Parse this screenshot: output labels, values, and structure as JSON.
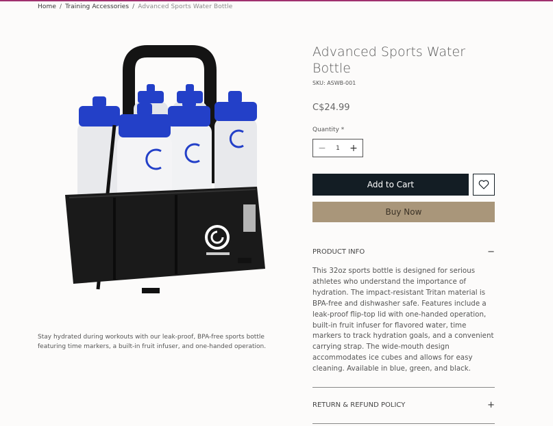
{
  "breadcrumb": {
    "home": "Home",
    "separator": "/",
    "category": "Training Accessories",
    "current": "Advanced Sports Water Bottle"
  },
  "product": {
    "title": "Advanced Sports Water Bottle",
    "sku": "SKU: ASWB-001",
    "price": "C$24.99",
    "short_description": "Stay hydrated during workouts with our leak-proof, BPA-free sports bottle featuring time markers, a built-in fruit infuser, and one-handed operation.",
    "image_icon": "product-photo"
  },
  "quantity": {
    "label": "Quantity *",
    "value": "1",
    "decrement_icon": "minus-icon",
    "increment_icon": "plus-icon"
  },
  "actions": {
    "add_to_cart": "Add to Cart",
    "wishlist_icon": "heart-icon",
    "buy_now": "Buy Now"
  },
  "sections": {
    "product_info": {
      "title": "PRODUCT INFO",
      "toggle": "−",
      "text": "This 32oz sports bottle is designed for serious athletes who understand the importance of hydration. The impact-resistant Tritan material is BPA-free and dishwasher safe. Features include a leak-proof flip-top lid with one-handed operation, built-in fruit infuser for flavored water, time markers to track hydration goals, and a convenient carrying strap. The wide-mouth design accommodates ice cubes and allows for easy cleaning. Available in blue, green, and black."
    },
    "refund": {
      "title": "RETURN & REFUND POLICY",
      "toggle": "+"
    }
  },
  "colors": {
    "accent_line": "#a0306e",
    "add_to_cart_bg": "#131d24",
    "buy_now_bg": "#a9967a",
    "bottle_cap": "#2340c8"
  }
}
